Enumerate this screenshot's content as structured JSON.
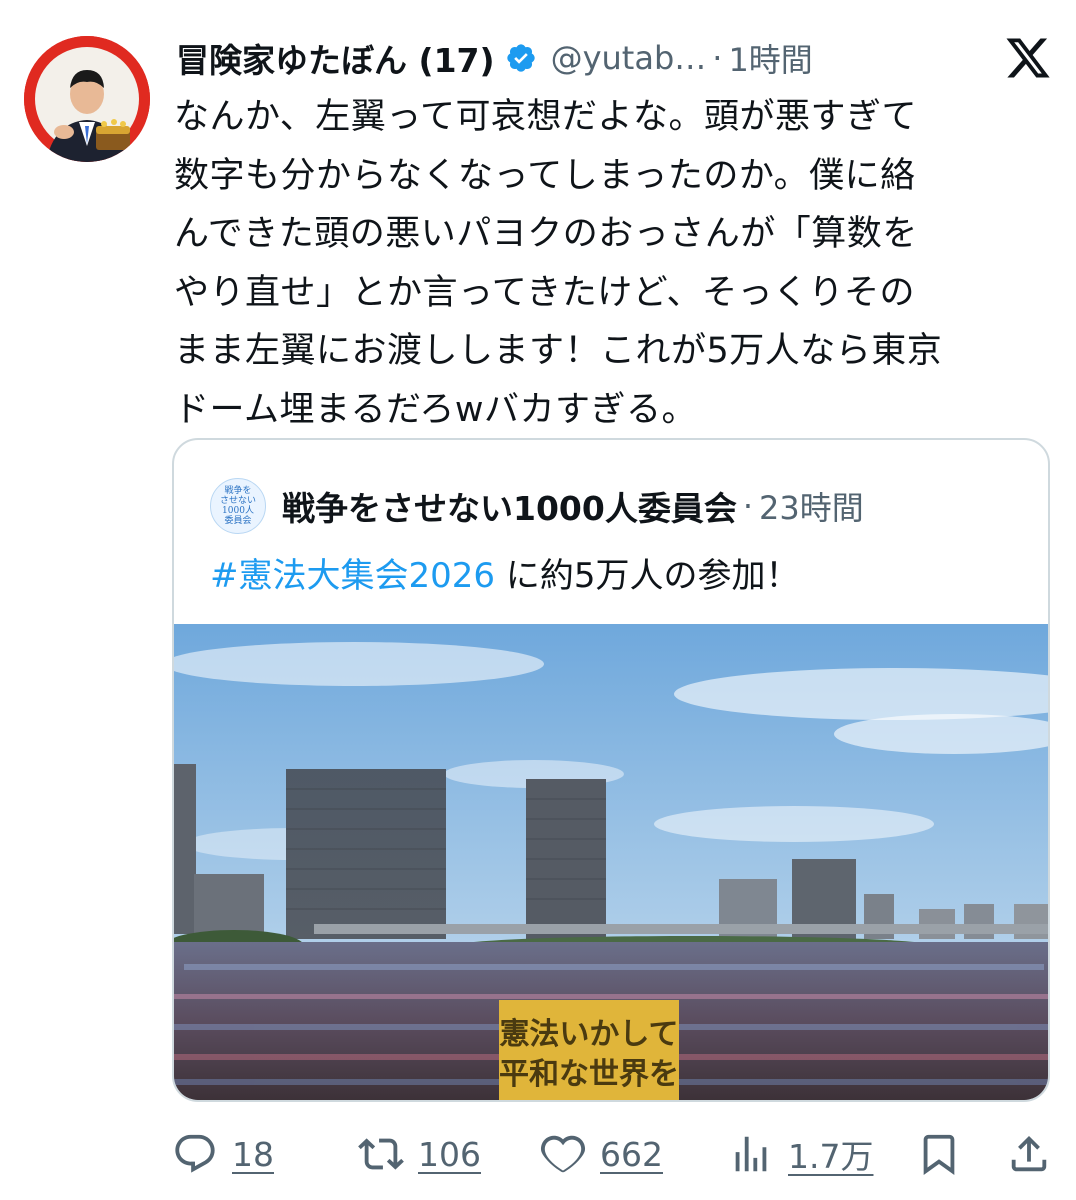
{
  "tweet": {
    "author_name": "冒険家ゆたぼん (17)",
    "handle": "@yutab…",
    "dot": "·",
    "time": "1時間",
    "text": "なんか、左翼って可哀想だよな。頭が悪すぎて\n数字も分からなくなってしまったのか。僕に絡\nんできた頭の悪いパヨクのおっさんが「算数を\nやり直せ」とか言ってきたけど、そっくりその\nまま左翼にお渡しします！これが5万人なら東京\nドーム埋まるだろwバカすぎる。",
    "avatar_icon": "profile-photo",
    "verified_icon": "verified-badge-icon",
    "platform_icon": "x-logo-icon"
  },
  "quote": {
    "avatar_text": [
      "戦争を",
      "させない",
      "1000人",
      "委員会"
    ],
    "author_name": "戦争をさせない1000人委員会",
    "dot": "·",
    "time": "23時間",
    "hashtag": "#憲法大集会2026",
    "text_rest": " に約5万人の参加！",
    "image": {
      "description_icon": "crowd-rally-photo",
      "sign_text_line1": "憲法いかして",
      "sign_text_line2": "平和な世界を"
    }
  },
  "actions": {
    "reply_count": "18",
    "repost_count": "106",
    "like_count": "662",
    "views_count": "1.7万"
  },
  "colors": {
    "text": "#0f1419",
    "secondary": "#536471",
    "link": "#1d9bf0",
    "border": "#cfd9de",
    "verified": "#1d9bf0"
  }
}
